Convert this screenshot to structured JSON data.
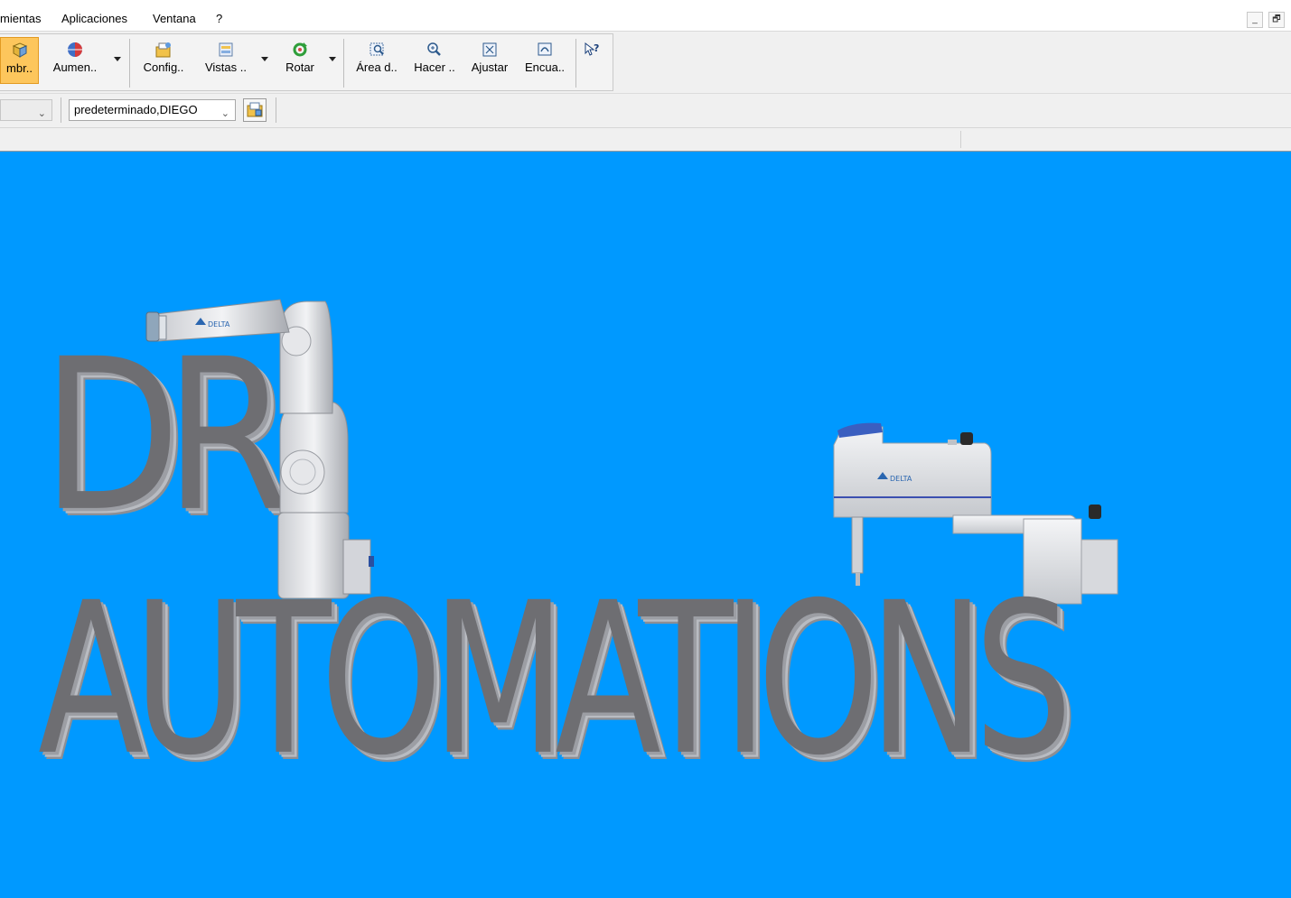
{
  "menubar": {
    "items": [
      "mientas",
      "Aplicaciones",
      "Ventana",
      "?"
    ],
    "window_controls": [
      "_",
      "🗗"
    ]
  },
  "toolbar": {
    "buttons": [
      {
        "label": "mbr..",
        "icon": "cube-icon",
        "active": true
      },
      {
        "label": "Aumen..",
        "icon": "globe-icon"
      },
      {
        "label": "Config..",
        "icon": "folder-config-icon"
      },
      {
        "label": "Vistas ..",
        "icon": "views-icon"
      },
      {
        "label": "Rotar",
        "icon": "rotate-icon"
      },
      {
        "label": "Área d..",
        "icon": "zoom-area-icon"
      },
      {
        "label": "Hacer ..",
        "icon": "zoom-in-icon"
      },
      {
        "label": "Ajustar",
        "icon": "fit-icon"
      },
      {
        "label": "Encua..",
        "icon": "frame-icon"
      },
      {
        "label": "",
        "icon": "help-pointer-icon"
      }
    ]
  },
  "toolbar2": {
    "user_combo": "predeterminado,DIEGO"
  },
  "viewport": {
    "background": "#0099ff",
    "text_line1": "DR",
    "text_line2": "AUTOMATIONS",
    "robot_brand": "DELTA"
  }
}
